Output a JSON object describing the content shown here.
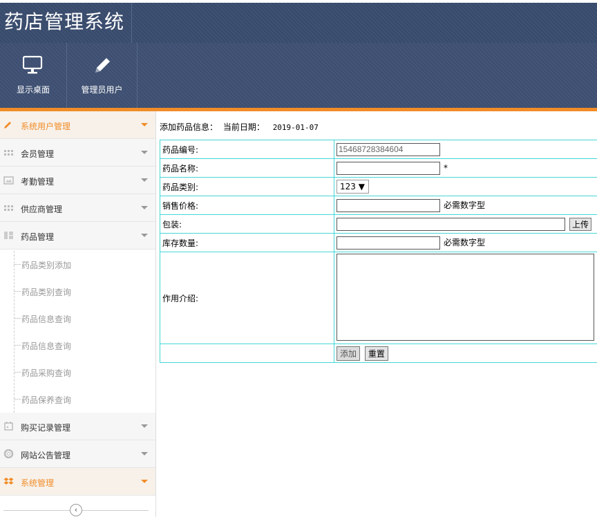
{
  "header": {
    "title": "药店管理系统"
  },
  "toolbar": {
    "items": [
      {
        "label": "显示桌面",
        "icon": "monitor-icon"
      },
      {
        "label": "管理员用户",
        "icon": "pencil-icon"
      }
    ]
  },
  "sidebar": {
    "items": [
      {
        "label": "系统用户管理",
        "icon": "pencil-icon",
        "active": true
      },
      {
        "label": "会员管理",
        "icon": "grid-icon"
      },
      {
        "label": "考勤管理",
        "icon": "image-icon"
      },
      {
        "label": "供应商管理",
        "icon": "grid-icon"
      },
      {
        "label": "药品管理",
        "icon": "layout-icon"
      }
    ],
    "sub_items": [
      "药品类别添加",
      "药品类别查询",
      "药品信息查询",
      "药品信息查询",
      "药品采购查询",
      "药品保养查询"
    ],
    "items_after": [
      {
        "label": "购买记录管理",
        "icon": "calendar-icon"
      },
      {
        "label": "网站公告管理",
        "icon": "lifebuoy-icon"
      },
      {
        "label": "系统管理",
        "icon": "dropbox-icon",
        "active": true
      }
    ],
    "collapse_glyph": "‹"
  },
  "main": {
    "info_label": "添加药品信息：",
    "date_label": "当前日期：",
    "date_value": "2019-01-07",
    "form": {
      "code_label": "药品编号:",
      "code_value": "15468728384604",
      "name_label": "药品名称:",
      "required_mark": "*",
      "category_label": "药品类别:",
      "category_value": "123",
      "price_label": "销售价格:",
      "price_hint": "必需数字型",
      "package_label": "包装:",
      "upload_label": "上传",
      "stock_label": "库存数量:",
      "stock_hint": "必需数字型",
      "intro_label": "作用介绍:",
      "add_label": "添加",
      "reset_label": "重置"
    }
  },
  "colors": {
    "accent": "#f28c28",
    "header": "#3a4c6e",
    "table_border": "#45d6d6"
  }
}
